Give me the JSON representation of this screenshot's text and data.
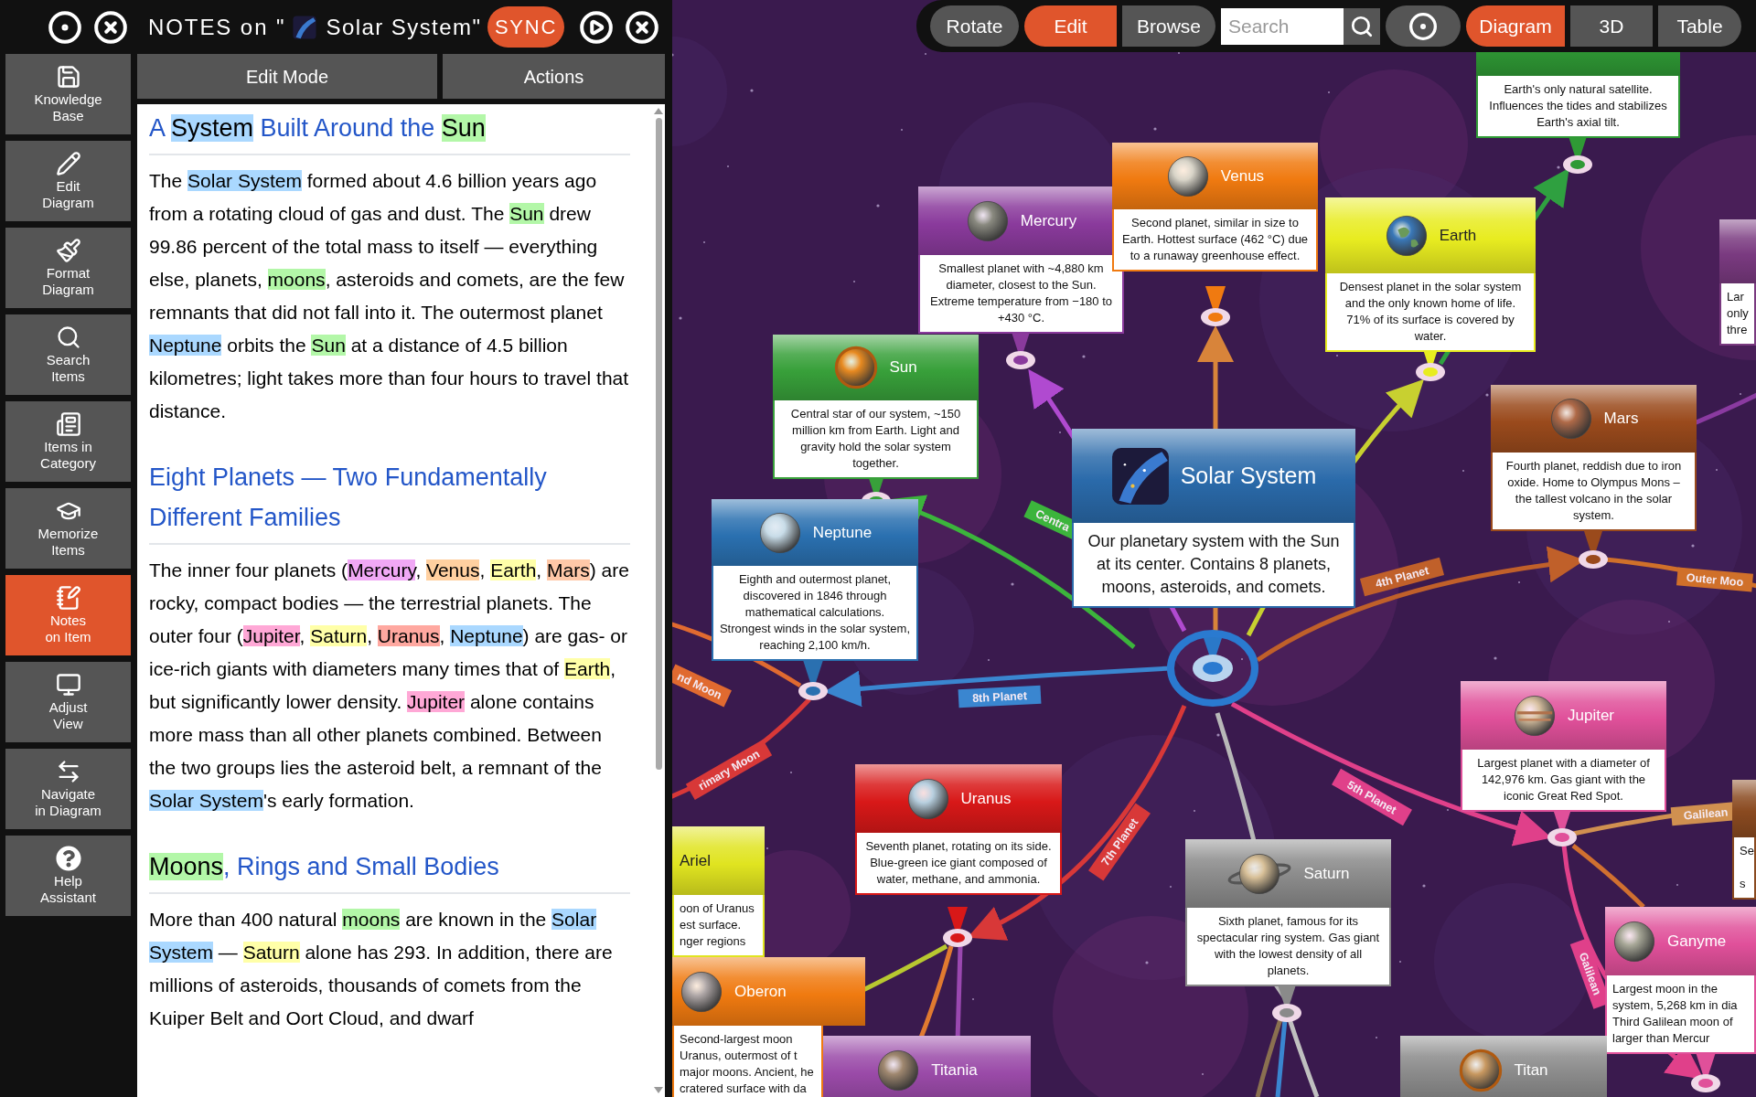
{
  "notes_header": {
    "title_prefix": "NOTES on \"",
    "title_item": "Solar System\"",
    "sync_button": "SYNC"
  },
  "sidebar": {
    "items": [
      {
        "label": "Knowledge\nBase",
        "selected": false
      },
      {
        "label": "Edit\nDiagram",
        "selected": false
      },
      {
        "label": "Format\nDiagram",
        "selected": false
      },
      {
        "label": "Search\nItems",
        "selected": false
      },
      {
        "label": "Items in\nCategory",
        "selected": false
      },
      {
        "label": "Memorize\nItems",
        "selected": false
      },
      {
        "label": "Notes\non Item",
        "selected": true
      },
      {
        "label": "Adjust\nView",
        "selected": false
      },
      {
        "label": "Navigate\nin Diagram",
        "selected": false
      },
      {
        "label": "Help\nAssistant",
        "selected": false
      }
    ]
  },
  "notes_tabs": [
    "Edit Mode",
    "Actions"
  ],
  "notes": {
    "blocks": [
      {
        "kind": "heading",
        "segments": [
          {
            "text": "A "
          },
          {
            "text": "System",
            "color": "#aad8ff"
          },
          {
            "text": " Built Around the "
          },
          {
            "text": "Sun",
            "color": "#b3f7a8"
          }
        ]
      },
      {
        "kind": "paragraph",
        "segments": [
          {
            "text": "The "
          },
          {
            "text": "Solar System",
            "color": "#aad8ff"
          },
          {
            "text": " formed about 4.6 billion years ago from a rotating cloud of gas and dust. The "
          },
          {
            "text": "Sun",
            "color": "#b3f7a8"
          },
          {
            "text": " drew 99.86 percent of the total mass to itself — everything else, planets, "
          },
          {
            "text": "moons",
            "color": "#b3f7a8"
          },
          {
            "text": ", asteroids and comets, are the few remnants that did not fall into it. The outermost planet "
          },
          {
            "text": "Neptune",
            "color": "#aad8ff"
          },
          {
            "text": " orbits the "
          },
          {
            "text": "Sun",
            "color": "#b3f7a8"
          },
          {
            "text": " at a distance of 4.5 billion kilometres; light takes more than four hours to travel that distance."
          }
        ]
      },
      {
        "kind": "heading",
        "segments": [
          {
            "text": "Eight Planets — Two Fundamentally Different Families"
          }
        ]
      },
      {
        "kind": "paragraph",
        "segments": [
          {
            "text": "The inner four planets ("
          },
          {
            "text": "Mercury",
            "color": "#f0a8f5"
          },
          {
            "text": ", "
          },
          {
            "text": "Venus",
            "color": "#ffd0a0"
          },
          {
            "text": ", "
          },
          {
            "text": "Earth",
            "color": "#ffffa8"
          },
          {
            "text": ", "
          },
          {
            "text": "Mars",
            "color": "#ffc8a8"
          },
          {
            "text": ") are rocky, compact bodies — the terrestrial planets. The outer four ("
          },
          {
            "text": "Jupiter",
            "color": "#ffa8d6"
          },
          {
            "text": ", "
          },
          {
            "text": "Saturn",
            "color": "#ffffa8"
          },
          {
            "text": ", "
          },
          {
            "text": "Uranus",
            "color": "#ffa8a0"
          },
          {
            "text": ", "
          },
          {
            "text": "Neptune",
            "color": "#aad8ff"
          },
          {
            "text": ") are gas- or ice-rich giants with diameters many times that of "
          },
          {
            "text": "Earth",
            "color": "#ffffa8"
          },
          {
            "text": ", but significantly lower density. "
          },
          {
            "text": "Jupiter",
            "color": "#ffa8d6"
          },
          {
            "text": " alone contains more mass than all other planets combined. Between the two groups lies the asteroid belt, a remnant of the "
          },
          {
            "text": "Solar System",
            "color": "#aad8ff"
          },
          {
            "text": "'s early formation."
          }
        ]
      },
      {
        "kind": "heading",
        "segments": [
          {
            "text": "Moons",
            "color": "#b3f7a8"
          },
          {
            "text": ", Rings and Small Bodies"
          }
        ]
      },
      {
        "kind": "paragraph",
        "segments": [
          {
            "text": "More than 400 natural "
          },
          {
            "text": "moons",
            "color": "#b3f7a8"
          },
          {
            "text": " are known in the "
          },
          {
            "text": "Solar System",
            "color": "#aad8ff"
          },
          {
            "text": " — "
          },
          {
            "text": "Saturn",
            "color": "#ffffa8"
          },
          {
            "text": " alone has 293. In addition, there are millions of asteroids, thousands of comets from the Kuiper Belt and Oort Cloud, and dwarf"
          }
        ]
      }
    ]
  },
  "toolbar": {
    "modes": [
      {
        "label": "Rotate",
        "selected": false
      },
      {
        "label": "Edit",
        "selected": true
      },
      {
        "label": "Browse",
        "selected": false
      }
    ],
    "search": {
      "placeholder": "Search"
    },
    "views": [
      {
        "label": "Diagram",
        "selected": true
      },
      {
        "label": "3D",
        "selected": false
      },
      {
        "label": "Table",
        "selected": false
      }
    ]
  },
  "diagram": {
    "cards": [
      {
        "description": "Earth's only natural satellite. Influences the tides and stabilizes Earth's axial tilt.",
        "color": "#2f9a35"
      },
      {
        "title": "Mercury",
        "description": "Smallest planet with ~4,880 km diameter, closest to the Sun. Extreme temperature from −180 to +430 °C.",
        "color": "#8a3a9c"
      },
      {
        "title": "Venus",
        "description": "Second planet, similar in size to Earth. Hottest surface (462 °C) due to a runaway greenhouse effect.",
        "color": "#f07a10"
      },
      {
        "title": "Earth",
        "description": "Densest planet in the solar system and the only known home of life. 71% of its surface is covered by water.",
        "color": "#e8ec20"
      },
      {
        "description": "Lar\nonly\nthre",
        "color": "#7a3a80"
      },
      {
        "title": "Sun",
        "description": "Central star of our system, ~150 million km from Earth. Light and gravity hold the solar system together.",
        "color": "#38a03a"
      },
      {
        "title": "Mars",
        "description": "Fourth planet, reddish due to iron oxide. Home to Olympus Mons – the tallest volcano in the solar system.",
        "color": "#9a4a1c"
      },
      {
        "title": "Solar System",
        "description": "Our planetary system with the Sun at its center. Contains 8 planets, moons, asteroids, and comets.",
        "color": "#2a6aaa"
      },
      {
        "title": "Neptune",
        "description": "Eighth and outermost planet, discovered in 1846 through mathematical calculations. Strongest winds in the solar system, reaching 2,100 km/h.",
        "color": "#2a70b0"
      },
      {
        "title": "Jupiter",
        "description": "Largest planet with a diameter of 142,976 km. Gas giant with the iconic Great Red Spot.",
        "color": "#e0509a"
      },
      {
        "description": "Se\n\ns",
        "color": "#8a4a20"
      },
      {
        "title": "Uranus",
        "description": "Seventh planet, rotating on its side. Blue-green ice giant composed of water, methane, and ammonia.",
        "color": "#d81818"
      },
      {
        "title": "Saturn",
        "description": "Sixth planet, famous for its spectacular ring system. Gas giant with the lowest density of all planets.",
        "color": "#8a8a8a"
      },
      {
        "title": "Ariel",
        "description": "oon of Uranus\nest surface.\nnger regions",
        "color": "#e0e420"
      },
      {
        "title": "Oberon",
        "description": "Second-largest moon\nUranus, outermost of t\nmajor moons. Ancient, he\ncratered surface with da",
        "color": "#f07a10"
      },
      {
        "title": "Titania",
        "color": "#9a4aa8"
      },
      {
        "title": "Ganyme",
        "description": "Largest moon in the\nsystem, 5,268 km in dia\nThird Galilean moon of\nlarger than Mercur",
        "color": "#e0509a"
      },
      {
        "title": "Titan",
        "color": "#8a8a8a"
      }
    ],
    "edge_labels": [
      {
        "text": "Centra",
        "color": "#3cb43c"
      },
      {
        "text": "nd Moon",
        "color": "#e06a30"
      },
      {
        "text": "rimary Moon",
        "color": "#d83838"
      },
      {
        "text": "8th Planet",
        "color": "#3a86d0"
      },
      {
        "text": "7th Planet",
        "color": "#d83838"
      },
      {
        "text": "4th Planet",
        "color": "#c0602a"
      },
      {
        "text": "Outer Moo",
        "color": "#d0702a"
      },
      {
        "text": "5th Planet",
        "color": "#e0408a"
      },
      {
        "text": "Galilean",
        "color": "#d09050"
      },
      {
        "text": "Galilean",
        "color": "#e0408a"
      }
    ]
  }
}
